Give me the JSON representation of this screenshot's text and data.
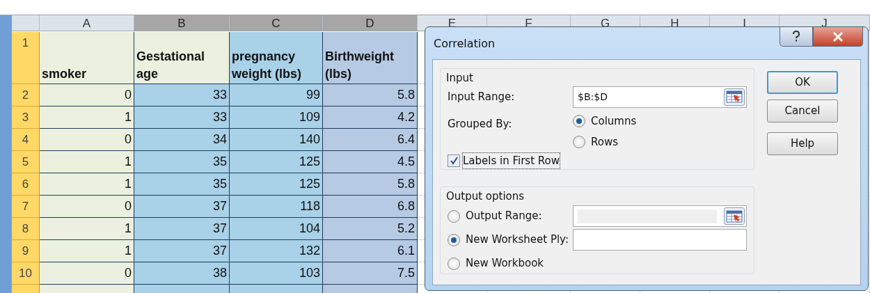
{
  "sheet": {
    "columns": [
      {
        "label": "A",
        "selected": false,
        "color": "#ebf1de"
      },
      {
        "label": "B",
        "selected": true,
        "color": "#a9d1e8"
      },
      {
        "label": "C",
        "selected": true,
        "color": "#a9d1e8"
      },
      {
        "label": "D",
        "selected": true,
        "color": "#b6cae3"
      },
      {
        "label": "E",
        "selected": false
      },
      {
        "label": "F",
        "selected": false
      },
      {
        "label": "G",
        "selected": false
      },
      {
        "label": "H",
        "selected": false
      },
      {
        "label": "I",
        "selected": false
      },
      {
        "label": "J",
        "selected": false
      }
    ],
    "header_row": {
      "number": "1",
      "cells": [
        {
          "text": "smoker",
          "active": false
        },
        {
          "text": "Gestational age",
          "active": true
        },
        {
          "text": "pregnancy weight (lbs)",
          "active": false
        },
        {
          "text": "Birthweight (lbs)",
          "active": false
        }
      ]
    },
    "rows": [
      {
        "number": "2",
        "cells": [
          "0",
          "33",
          "99",
          "5.8"
        ]
      },
      {
        "number": "3",
        "cells": [
          "1",
          "33",
          "109",
          "4.2"
        ]
      },
      {
        "number": "4",
        "cells": [
          "0",
          "34",
          "140",
          "6.4"
        ]
      },
      {
        "number": "5",
        "cells": [
          "1",
          "35",
          "125",
          "4.5"
        ]
      },
      {
        "number": "6",
        "cells": [
          "1",
          "35",
          "125",
          "5.8"
        ]
      },
      {
        "number": "7",
        "cells": [
          "0",
          "37",
          "118",
          "6.8"
        ]
      },
      {
        "number": "8",
        "cells": [
          "1",
          "37",
          "104",
          "5.2"
        ]
      },
      {
        "number": "9",
        "cells": [
          "1",
          "37",
          "132",
          "6.1"
        ]
      },
      {
        "number": "10",
        "cells": [
          "0",
          "38",
          "103",
          "7.5"
        ]
      }
    ]
  },
  "dialog": {
    "title": "Correlation",
    "input_group": {
      "title": "Input",
      "input_range": {
        "label": "Input Range:",
        "value": "$B:$D"
      },
      "grouped_by": {
        "label": "Grouped By:",
        "options": [
          {
            "label": "Columns",
            "selected": true
          },
          {
            "label": "Rows",
            "selected": false
          }
        ]
      },
      "labels_checkbox": {
        "label": "Labels in First Row",
        "checked": true
      }
    },
    "output_group": {
      "title": "Output options",
      "options": [
        {
          "label": "Output Range:",
          "selected": false,
          "kind": "range"
        },
        {
          "label": "New Worksheet Ply:",
          "selected": true,
          "kind": "text"
        },
        {
          "label": "New Workbook",
          "selected": false,
          "kind": "none"
        }
      ]
    },
    "buttons": [
      {
        "label": "OK",
        "default": true
      },
      {
        "label": "Cancel",
        "default": false
      },
      {
        "label": "Help",
        "default": false
      }
    ]
  }
}
